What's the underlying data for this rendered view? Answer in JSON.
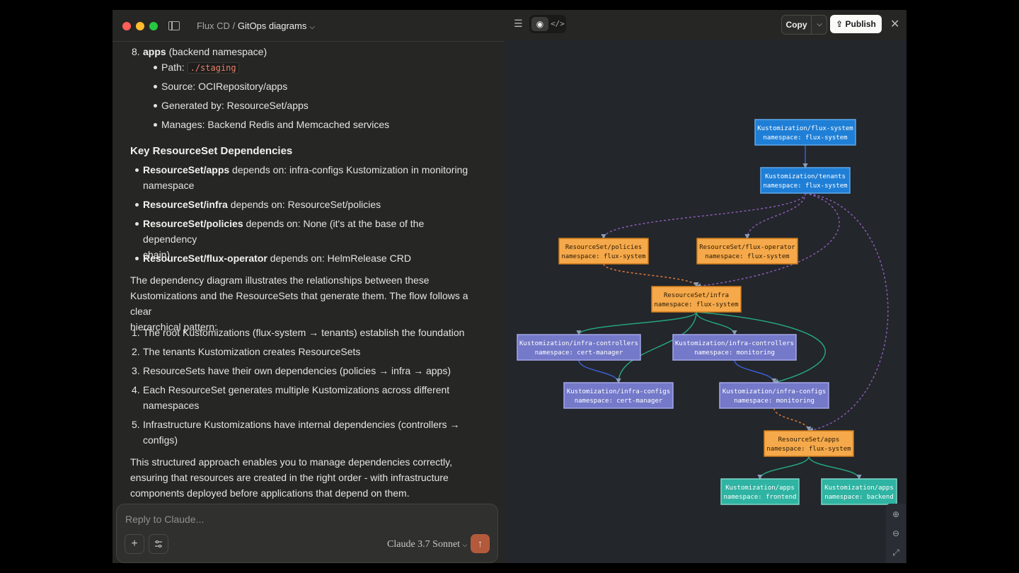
{
  "titlebar": {
    "breadcrumb_parent": "Flux CD",
    "separator": "/",
    "breadcrumb_current": "GitOps diagrams"
  },
  "content": {
    "item8": {
      "num": "8.",
      "name": "apps",
      "desc": "(backend namespace)",
      "path_label": "Path:",
      "path_value": "./staging",
      "bullets": [
        "Source: OCIRepository/apps",
        "Generated by: ResourceSet/apps",
        "Manages: Backend Redis and Memcached services"
      ]
    },
    "deps_heading": "Key ResourceSet Dependencies",
    "deps": [
      {
        "name": "ResourceSet/apps",
        "text": " depends on: infra-configs Kustomization in monitoring",
        "cont": "namespace"
      },
      {
        "name": "ResourceSet/infra",
        "text": " depends on: ResourceSet/policies",
        "cont": ""
      },
      {
        "name": "ResourceSet/policies",
        "text": " depends on: None (it's at the base of the dependency",
        "cont": "chain)"
      },
      {
        "name": "ResourceSet/flux-operator",
        "text": " depends on: HelmRelease CRD",
        "cont": ""
      }
    ],
    "para1": [
      "The dependency diagram illustrates the relationships between these",
      "Kustomizations and the ResourceSets that generate them. The flow follows a clear",
      "hierarchical pattern:"
    ],
    "steps": [
      {
        "num": "1.",
        "lines": [
          "The root Kustomizations (flux-system → tenants) establish the foundation"
        ]
      },
      {
        "num": "2.",
        "lines": [
          "The tenants Kustomization creates ResourceSets"
        ]
      },
      {
        "num": "3.",
        "lines": [
          "ResourceSets have their own dependencies (policies → infra → apps)"
        ]
      },
      {
        "num": "4.",
        "lines": [
          "Each ResourceSet generates multiple Kustomizations across different",
          "namespaces"
        ]
      },
      {
        "num": "5.",
        "lines": [
          "Infrastructure Kustomizations have internal dependencies (controllers →",
          "configs)"
        ]
      }
    ],
    "para2": [
      "This structured approach enables you to manage dependencies correctly,",
      "ensuring that resources are created in the right order - with infrastructure",
      "components deployed before applications that depend on them."
    ]
  },
  "composer": {
    "placeholder": "Reply to Claude...",
    "model": "Claude 3.7 Sonnet",
    "add_icon": "plus-icon",
    "settings_icon": "sliders-icon",
    "send_icon": "arrow-up-icon"
  },
  "artifact_toolbar": {
    "list_icon": "list-icon",
    "preview_icon": "eye-icon",
    "code_icon": "code-icon",
    "copy_label": "Copy",
    "publish_label": "Publish",
    "close_icon": "close-icon"
  },
  "diagram": {
    "colors": {
      "kustomization_root": "#1f7fd6",
      "resourceset": "#f5a94a",
      "kustomization_infra": "#7479c9",
      "kustomization_apps": "#2fb3a2",
      "edge_purple": "#8a5ab5",
      "edge_green": "#26a37e",
      "edge_blue": "#3b5fd1",
      "edge_orange": "#e0793a"
    },
    "nodes": [
      {
        "id": "fs",
        "l1": "Kustomization/flux-system",
        "l2": "namespace: flux-system",
        "kind": "root"
      },
      {
        "id": "tn",
        "l1": "Kustomization/tenants",
        "l2": "namespace: flux-system",
        "kind": "root"
      },
      {
        "id": "pol",
        "l1": "ResourceSet/policies",
        "l2": "namespace: flux-system",
        "kind": "rs"
      },
      {
        "id": "fo",
        "l1": "ResourceSet/flux-operator",
        "l2": "namespace: flux-system",
        "kind": "rs"
      },
      {
        "id": "inf",
        "l1": "ResourceSet/infra",
        "l2": "namespace: flux-system",
        "kind": "rs"
      },
      {
        "id": "icc",
        "l1": "Kustomization/infra-controllers",
        "l2": "namespace: cert-manager",
        "kind": "infra"
      },
      {
        "id": "icm",
        "l1": "Kustomization/infra-controllers",
        "l2": "namespace: monitoring",
        "kind": "infra"
      },
      {
        "id": "ifc",
        "l1": "Kustomization/infra-configs",
        "l2": "namespace: cert-manager",
        "kind": "infra"
      },
      {
        "id": "ifm",
        "l1": "Kustomization/infra-configs",
        "l2": "namespace: monitoring",
        "kind": "infra"
      },
      {
        "id": "rsa",
        "l1": "ResourceSet/apps",
        "l2": "namespace: flux-system",
        "kind": "rs"
      },
      {
        "id": "kaf",
        "l1": "Kustomization/apps",
        "l2": "namespace: frontend",
        "kind": "apps"
      },
      {
        "id": "kab",
        "l1": "Kustomization/apps",
        "l2": "namespace: backend",
        "kind": "apps"
      }
    ]
  },
  "zoom": {
    "in_icon": "zoom-in-icon",
    "out_icon": "zoom-out-icon",
    "fit_icon": "expand-icon"
  }
}
